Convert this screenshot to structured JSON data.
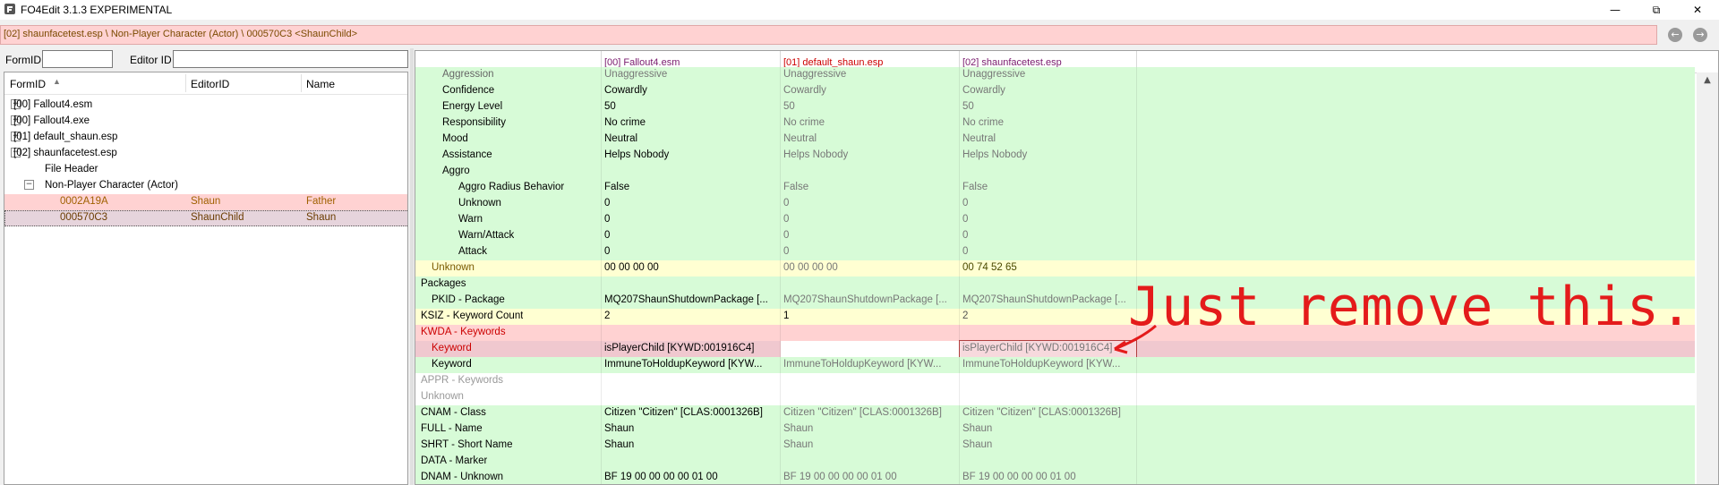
{
  "window": {
    "title": "FO4Edit 3.1.3 EXPERIMENTAL",
    "icon": "app-icon",
    "controls": {
      "minimize": "—",
      "restore": "⧉",
      "close": "✕"
    }
  },
  "path_bar": {
    "text": "[02] shaunfacetest.esp \\ Non-Player Character (Actor) \\ 000570C3 <ShaunChild>",
    "back_icon": "back-arrow-icon",
    "forward_icon": "forward-arrow-icon"
  },
  "filters": {
    "formid_label": "FormID",
    "formid_value": "",
    "editorid_label": "Editor ID",
    "editorid_value": ""
  },
  "tree": {
    "columns": [
      "FormID",
      "EditorID",
      "Name"
    ],
    "rows": [
      {
        "text": "[00] Fallout4.esm",
        "editorid": "",
        "name": "",
        "expander": "+"
      },
      {
        "text": "[00] Fallout4.exe",
        "editorid": "",
        "name": "",
        "expander": "+"
      },
      {
        "text": "[01] default_shaun.esp",
        "editorid": "",
        "name": "",
        "expander": "+"
      },
      {
        "text": "[02] shaunfacetest.esp",
        "editorid": "",
        "name": "",
        "expander": "−"
      },
      {
        "text": "File Header",
        "editorid": "",
        "name": "",
        "expander": ""
      },
      {
        "text": "Non-Player Character (Actor)",
        "editorid": "",
        "name": "",
        "expander": "−"
      },
      {
        "text": "0002A19A",
        "editorid": "Shaun",
        "name": "Father",
        "expander": ""
      },
      {
        "text": "000570C3",
        "editorid": "ShaunChild",
        "name": "Shaun",
        "expander": ""
      }
    ]
  },
  "grid": {
    "columns": [
      "",
      "[00] Fallout4.esm",
      "[01] default_shaun.esp",
      "[02] shaunfacetest.esp"
    ],
    "rows": [
      {
        "label": "Aggression",
        "v0": "Unaggressive",
        "v1": "Unaggressive",
        "v2": "Unaggressive"
      },
      {
        "label": "Confidence",
        "v0": "Cowardly",
        "v1": "Cowardly",
        "v2": "Cowardly"
      },
      {
        "label": "Energy Level",
        "v0": "50",
        "v1": "50",
        "v2": "50"
      },
      {
        "label": "Responsibility",
        "v0": "No crime",
        "v1": "No crime",
        "v2": "No crime"
      },
      {
        "label": "Mood",
        "v0": "Neutral",
        "v1": "Neutral",
        "v2": "Neutral"
      },
      {
        "label": "Assistance",
        "v0": "Helps Nobody",
        "v1": "Helps Nobody",
        "v2": "Helps Nobody"
      },
      {
        "label": "Aggro",
        "v0": "",
        "v1": "",
        "v2": ""
      },
      {
        "label": "Aggro Radius Behavior",
        "v0": "False",
        "v1": "False",
        "v2": "False"
      },
      {
        "label": "Unknown",
        "v0": "0",
        "v1": "0",
        "v2": "0"
      },
      {
        "label": "Warn",
        "v0": "0",
        "v1": "0",
        "v2": "0"
      },
      {
        "label": "Warn/Attack",
        "v0": "0",
        "v1": "0",
        "v2": "0"
      },
      {
        "label": "Attack",
        "v0": "0",
        "v1": "0",
        "v2": "0"
      },
      {
        "label": "Unknown",
        "v0": "00 00 00 00",
        "v1": "00 00 00 00",
        "v2": "00 74 52 65"
      },
      {
        "label": "Packages",
        "v0": "",
        "v1": "",
        "v2": ""
      },
      {
        "label": "PKID - Package",
        "v0": "MQ207ShaunShutdownPackage [...",
        "v1": "MQ207ShaunShutdownPackage [...",
        "v2": "MQ207ShaunShutdownPackage [..."
      },
      {
        "label": "KSIZ - Keyword Count",
        "v0": "2",
        "v1": "1",
        "v2": "2"
      },
      {
        "label": "KWDA - Keywords",
        "v0": "",
        "v1": "",
        "v2": ""
      },
      {
        "label": "Keyword",
        "v0": "isPlayerChild [KYWD:001916C4]",
        "v1": "",
        "v2": "isPlayerChild [KYWD:001916C4]"
      },
      {
        "label": "Keyword",
        "v0": "ImmuneToHoldupKeyword [KYW...",
        "v1": "ImmuneToHoldupKeyword [KYW...",
        "v2": "ImmuneToHoldupKeyword [KYW..."
      },
      {
        "label": "APPR - Keywords",
        "v0": "",
        "v1": "",
        "v2": ""
      },
      {
        "label": "Unknown",
        "v0": "",
        "v1": "",
        "v2": ""
      },
      {
        "label": "CNAM - Class",
        "v0": "Citizen \"Citizen\" [CLAS:0001326B]",
        "v1": "Citizen \"Citizen\" [CLAS:0001326B]",
        "v2": "Citizen \"Citizen\" [CLAS:0001326B]"
      },
      {
        "label": "FULL - Name",
        "v0": "Shaun",
        "v1": "Shaun",
        "v2": "Shaun"
      },
      {
        "label": "SHRT - Short Name",
        "v0": "Shaun",
        "v1": "Shaun",
        "v2": "Shaun"
      },
      {
        "label": "DATA - Marker",
        "v0": "",
        "v1": "",
        "v2": ""
      },
      {
        "label": "DNAM - Unknown",
        "v0": "BF 19 00 00 00 00 01 00",
        "v1": "BF 19 00 00 00 00 01 00",
        "v2": "BF 19 00 00 00 00 01 00"
      }
    ]
  },
  "annotation": {
    "text": "Just remove this."
  },
  "colors": {
    "green_row": "#d7fbd7",
    "yellow_row": "#ffffd2",
    "pink_row": "#ffd2d2",
    "conflict_text": "#cc0000",
    "annotation": "#e41b1b"
  }
}
